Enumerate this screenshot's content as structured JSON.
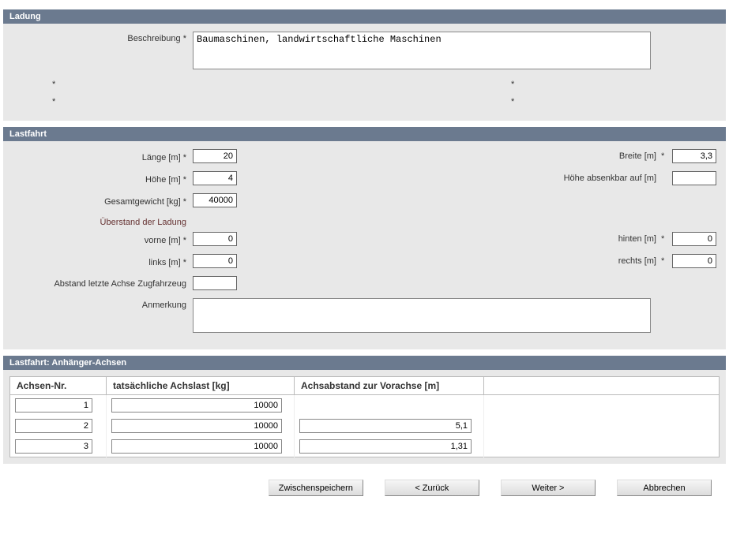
{
  "ladung": {
    "header": "Ladung",
    "beschreibung_label": "Beschreibung",
    "beschreibung_value": "Baumaschinen, landwirtschaftliche Maschinen"
  },
  "lastfahrt": {
    "header": "Lastfahrt",
    "laenge_label": "Länge [m]",
    "laenge_value": "20",
    "breite_label": "Breite [m]",
    "breite_value": "3,3",
    "hoehe_label": "Höhe [m]",
    "hoehe_value": "4",
    "hoehe_absenkbar_label": "Höhe absenkbar auf [m]",
    "hoehe_absenkbar_value": "",
    "gesamtgewicht_label": "Gesamtgewicht [kg]",
    "gesamtgewicht_value": "40000",
    "ueberstand_heading": "Überstand der Ladung",
    "vorne_label": "vorne [m]",
    "vorne_value": "0",
    "hinten_label": "hinten [m]",
    "hinten_value": "0",
    "links_label": "links [m]",
    "links_value": "0",
    "rechts_label": "rechts [m]",
    "rechts_value": "0",
    "abstand_label": "Abstand letzte Achse Zugfahrzeug",
    "abstand_value": "",
    "anmerkung_label": "Anmerkung",
    "anmerkung_value": ""
  },
  "achsen": {
    "header": "Lastfahrt: Anhänger-Achsen",
    "col_nr": "Achsen-Nr.",
    "col_last": "tatsächliche Achslast [kg]",
    "col_abstand": "Achsabstand zur Vorachse [m]",
    "rows": [
      {
        "nr": "1",
        "last": "10000",
        "abstand": ""
      },
      {
        "nr": "2",
        "last": "10000",
        "abstand": "5,1"
      },
      {
        "nr": "3",
        "last": "10000",
        "abstand": "1,31"
      }
    ]
  },
  "buttons": {
    "save": "Zwischenspeichern",
    "back": "< Zurück",
    "next": "Weiter >",
    "cancel": "Abbrechen"
  },
  "star": "*"
}
